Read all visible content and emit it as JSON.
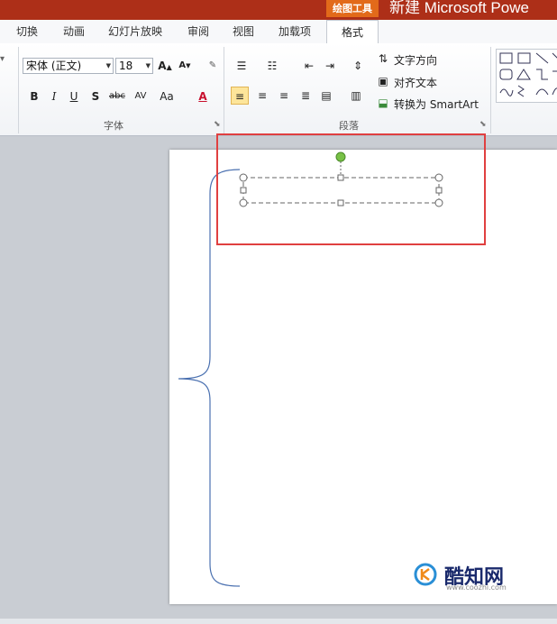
{
  "titlebar": {
    "context_tool": "绘图工具",
    "doc_title": "新建 Microsoft Powe"
  },
  "tabs": [
    "切换",
    "动画",
    "幻灯片放映",
    "审阅",
    "视图",
    "加载项"
  ],
  "active_tab": "格式",
  "font_group": {
    "label": "字体",
    "font_name": "宋体 (正文)",
    "font_size": "18",
    "buttons": [
      "B",
      "I",
      "U",
      "S",
      "abc",
      "AV",
      "Aa",
      "A"
    ]
  },
  "paragraph_group": {
    "label": "段落",
    "text_direction": "文字方向",
    "align_text": "对齐文本",
    "convert_smartart": "转换为 SmartArt"
  },
  "watermark": {
    "name": "酷知网",
    "url": "www.coozhi.com"
  },
  "colors": {
    "title_bar": "#ad2f18",
    "context_tab": "#e26a1a",
    "highlight_box": "#e04040",
    "brace": "#4a70b0",
    "rotate_handle": "#78c146"
  },
  "icons": [
    "bullets-icon",
    "numbering-icon",
    "line-spacing-icon",
    "align-left-icon",
    "align-center-icon",
    "align-right-icon",
    "justify-icon",
    "columns-icon",
    "shapes-gallery-icon"
  ]
}
